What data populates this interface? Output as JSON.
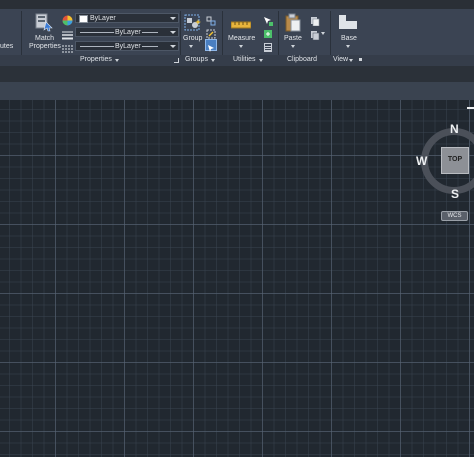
{
  "ribbon": {
    "cut_label": "utes",
    "match_properties": {
      "line1": "Match",
      "line2": "Properties"
    },
    "dropdowns": {
      "color": "ByLayer",
      "linetype": "ByLayer",
      "lineweight": "ByLayer"
    },
    "group_label": "Group",
    "measure_label": "Measure",
    "paste_label": "Paste",
    "base_label": "Base",
    "panels": {
      "properties": "Properties",
      "groups": "Groups",
      "utilities": "Utilities",
      "clipboard": "Clipboard",
      "view": "View"
    }
  },
  "viewcube": {
    "face": "TOP",
    "north": "N",
    "south": "S",
    "west": "W",
    "ucs_label": "WCS"
  },
  "colors": {
    "ribbon_bg": "#3b4453",
    "canvas_bg": "#212830",
    "grid_major": "#5a6676",
    "accent_blue": "#3a7bd5"
  }
}
